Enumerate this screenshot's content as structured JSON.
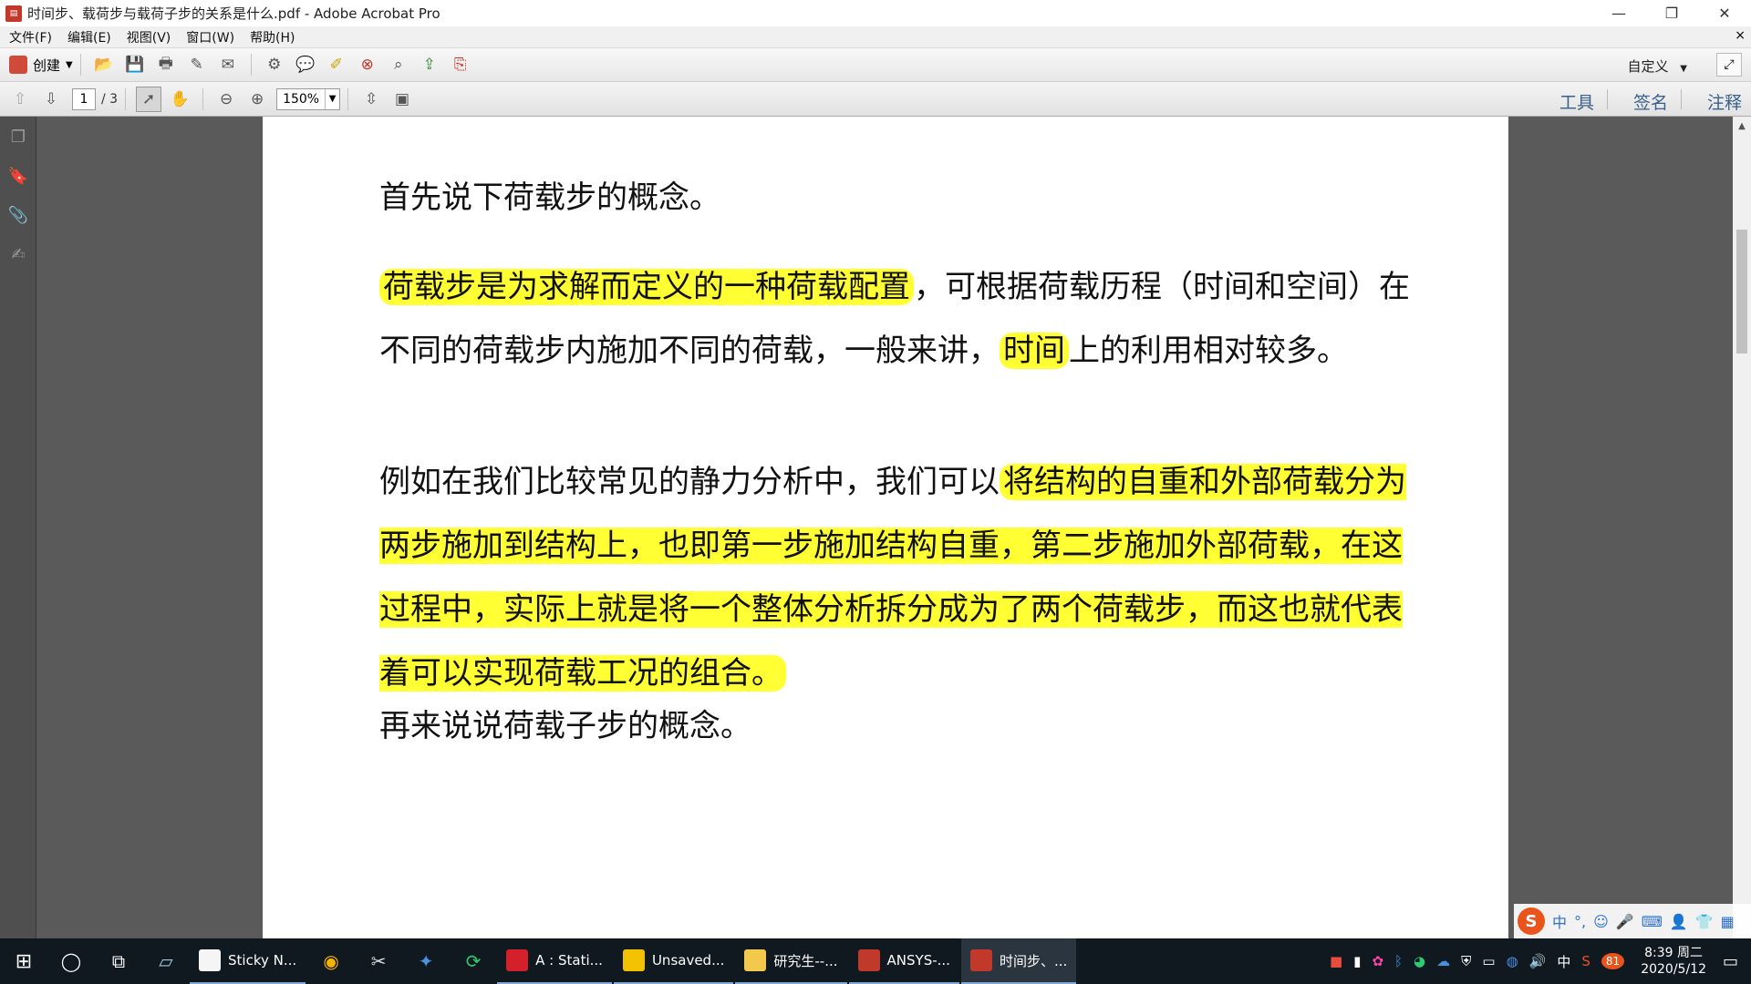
{
  "window": {
    "title": "时间步、载荷步与载荷子步的关系是什么.pdf - Adobe Acrobat Pro",
    "minimize": "—",
    "restore": "❐",
    "close": "✕"
  },
  "menu": {
    "items": [
      "文件(F)",
      "编辑(E)",
      "视图(V)",
      "窗口(W)",
      "帮助(H)"
    ],
    "close": "×"
  },
  "toolbar": {
    "create_label": "创建",
    "customize_label": "自定义"
  },
  "nav": {
    "page_current": "1",
    "page_total": "/ 3",
    "zoom": "150%"
  },
  "right_tabs": [
    "工具",
    "签名",
    "注释"
  ],
  "document": {
    "p1": "首先说下荷载步的概念。",
    "p2_hl1": "荷载步是为求解而定义的一种荷载配置",
    "p2_a": "，可根据荷载历程（时间和空间）在不同的荷载步内施加不同的荷载，一般来讲，",
    "p2_hl2": "时间",
    "p2_b": "上的利用相对较多。",
    "p3_a": "例如在我们比较常见的静力分析中，我们可以",
    "p3_hl": "将结构的自重和外部荷载分为两步施加到结构上，也即第一步施加结构自重，第二步施加外部荷载，在这过程中，实际上就是将一个整体分析拆分成为了两个荷载步，而这也就代表着可以实现荷载工况的组合。",
    "p4": "再来说说荷载子步的概念。"
  },
  "taskbar": {
    "apps": [
      {
        "label": "Sticky N...",
        "color": "#f5f5f5"
      },
      {
        "label": "A : Stati...",
        "color": "#d4202a"
      },
      {
        "label": "Unsaved...",
        "color": "#f2c200"
      },
      {
        "label": "研究生--...",
        "color": "#f2c94c"
      },
      {
        "label": "ANSYS-...",
        "color": "#c0392b"
      },
      {
        "label": "时间步、...",
        "color": "#c0392b"
      }
    ],
    "ime_lang": "中",
    "badge": "81",
    "time": "8:39 周二",
    "date": "2020/5/12"
  }
}
